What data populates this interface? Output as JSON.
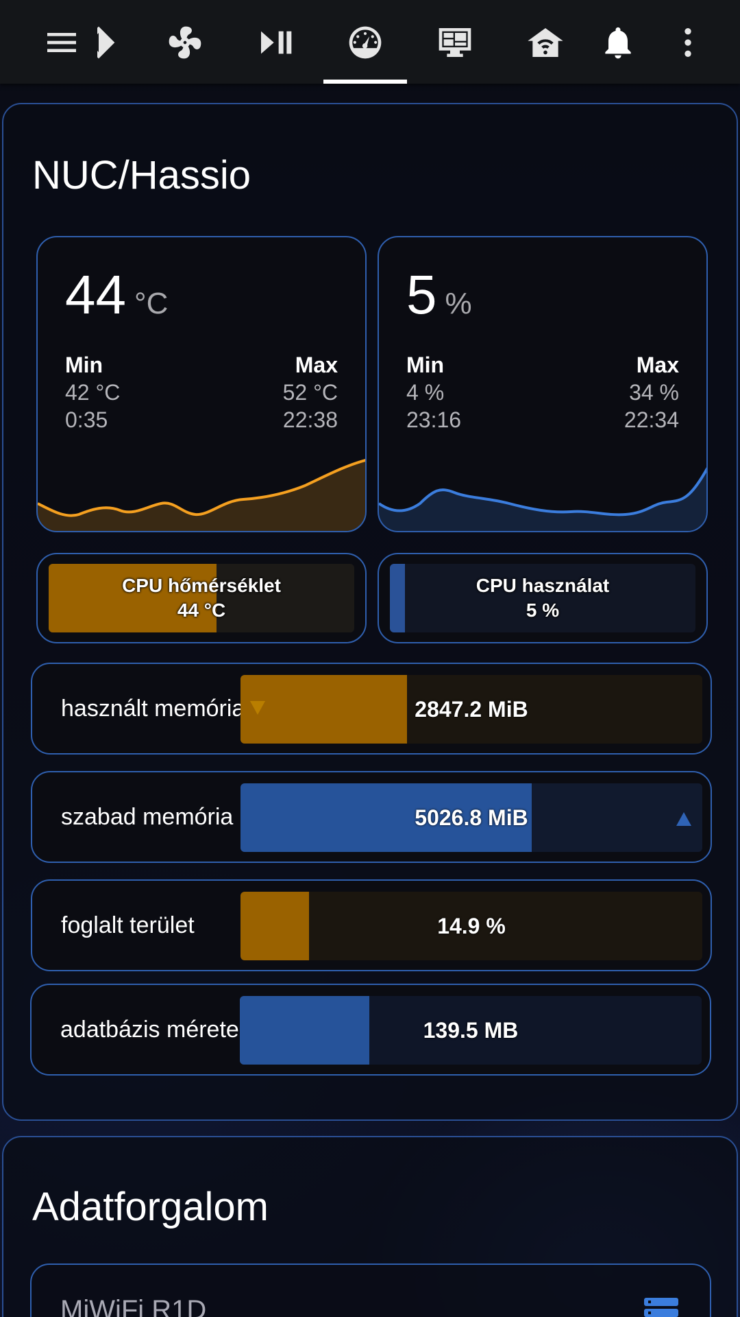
{
  "toolbar": {
    "icons": [
      "menu-icon",
      "partial-tab-icon",
      "fan-icon",
      "play-pause-icon",
      "speedometer-icon",
      "monitor-dashboard-icon",
      "home-wifi-icon",
      "bell-icon",
      "more-vertical-icon"
    ],
    "active_tab": "speedometer-icon"
  },
  "nuc_card": {
    "title": "NUC/Hassio",
    "temp_sensor": {
      "value": "44",
      "unit": "°C",
      "min_label": "Min",
      "min_value": "42 °C",
      "min_time": "0:35",
      "max_label": "Max",
      "max_value": "52 °C",
      "max_time": "22:38",
      "color": "#f5a020"
    },
    "cpu_sensor": {
      "value": "5",
      "unit": "%",
      "min_label": "Min",
      "min_value": "4 %",
      "min_time": "23:16",
      "max_label": "Max",
      "max_value": "34 %",
      "max_time": "22:34",
      "color": "#3b7ddd"
    },
    "gauges": [
      {
        "label": "CPU hőmérséklet",
        "value": "44 °C",
        "fraction": 0.55,
        "color": "#9a6200",
        "track": "#1c1a17"
      },
      {
        "label": "CPU használat",
        "value": "5 %",
        "fraction": 0.05,
        "color": "#2a5298",
        "track": "#111624"
      }
    ],
    "bars": [
      {
        "label": "használt memória",
        "value": "2847.2 MiB",
        "fraction": 0.36,
        "color": "#9a6200",
        "track": "#1b160f",
        "trend": "down"
      },
      {
        "label": "szabad memória",
        "value": "5026.8 MiB",
        "fraction": 0.63,
        "color": "#26539a",
        "track": "#111a2e",
        "trend": "up"
      },
      {
        "label": "foglalt terület",
        "value": "14.9 %",
        "fraction": 0.149,
        "color": "#9a6200",
        "track": "#1b160f",
        "trend": "none"
      },
      {
        "label": "adatbázis mérete",
        "value": "139.5 MB",
        "fraction": 0.28,
        "color": "#26539a",
        "track": "#0f1628",
        "trend": "none"
      }
    ]
  },
  "traffic_card": {
    "title": "Adatforgalom",
    "device_title": "MiWiFi R1D",
    "device_icon": "server-icon"
  }
}
